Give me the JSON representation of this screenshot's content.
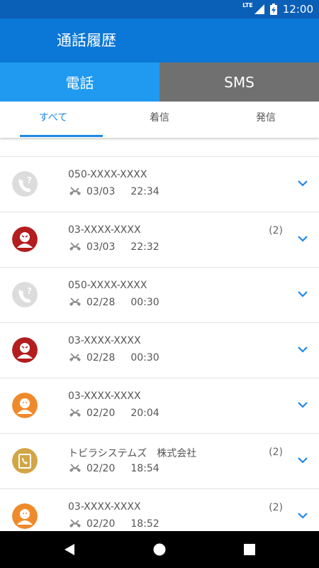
{
  "status_bar": {
    "network": "LTE",
    "time": "12:00"
  },
  "app_bar": {
    "title": "通話履歴"
  },
  "segments": {
    "phone": "電話",
    "sms": "SMS"
  },
  "tabs": [
    {
      "label": "すべて",
      "active": true
    },
    {
      "label": "着信",
      "active": false
    },
    {
      "label": "発信",
      "active": false
    }
  ],
  "calls": [
    {
      "number": "050-XXXX-XXXX",
      "date": "03/03",
      "time": "22:34",
      "count": "",
      "avatar": "unknown-caller-icon"
    },
    {
      "number": "03-XXXX-XXXX",
      "date": "03/03",
      "time": "22:32",
      "count": "(2)",
      "avatar": "red-caller-icon"
    },
    {
      "number": "050-XXXX-XXXX",
      "date": "02/28",
      "time": "00:30",
      "count": "",
      "avatar": "unknown-caller-icon"
    },
    {
      "number": "03-XXXX-XXXX",
      "date": "02/28",
      "time": "00:30",
      "count": "",
      "avatar": "red-caller-icon"
    },
    {
      "number": "03-XXXX-XXXX",
      "date": "02/20",
      "time": "20:04",
      "count": "",
      "avatar": "orange-caller-icon"
    },
    {
      "number": "トビラシステムズ　株式会社",
      "date": "02/20",
      "time": "18:54",
      "count": "(2)",
      "avatar": "phonebook-icon"
    },
    {
      "number": "03-XXXX-XXXX",
      "date": "02/20",
      "time": "18:52",
      "count": "(2)",
      "avatar": "orange-caller-icon"
    }
  ],
  "colors": {
    "status_bar": "#0a5fb7",
    "app_bar": "#0b77d6",
    "segment_active": "#1f9af0",
    "segment_inactive": "#707070",
    "tab_active": "#1e88e5",
    "red_caller": "#b31d1d",
    "orange_caller": "#ef8a2c",
    "unknown_caller": "#dcdcdc",
    "phonebook": "#d2a545"
  }
}
